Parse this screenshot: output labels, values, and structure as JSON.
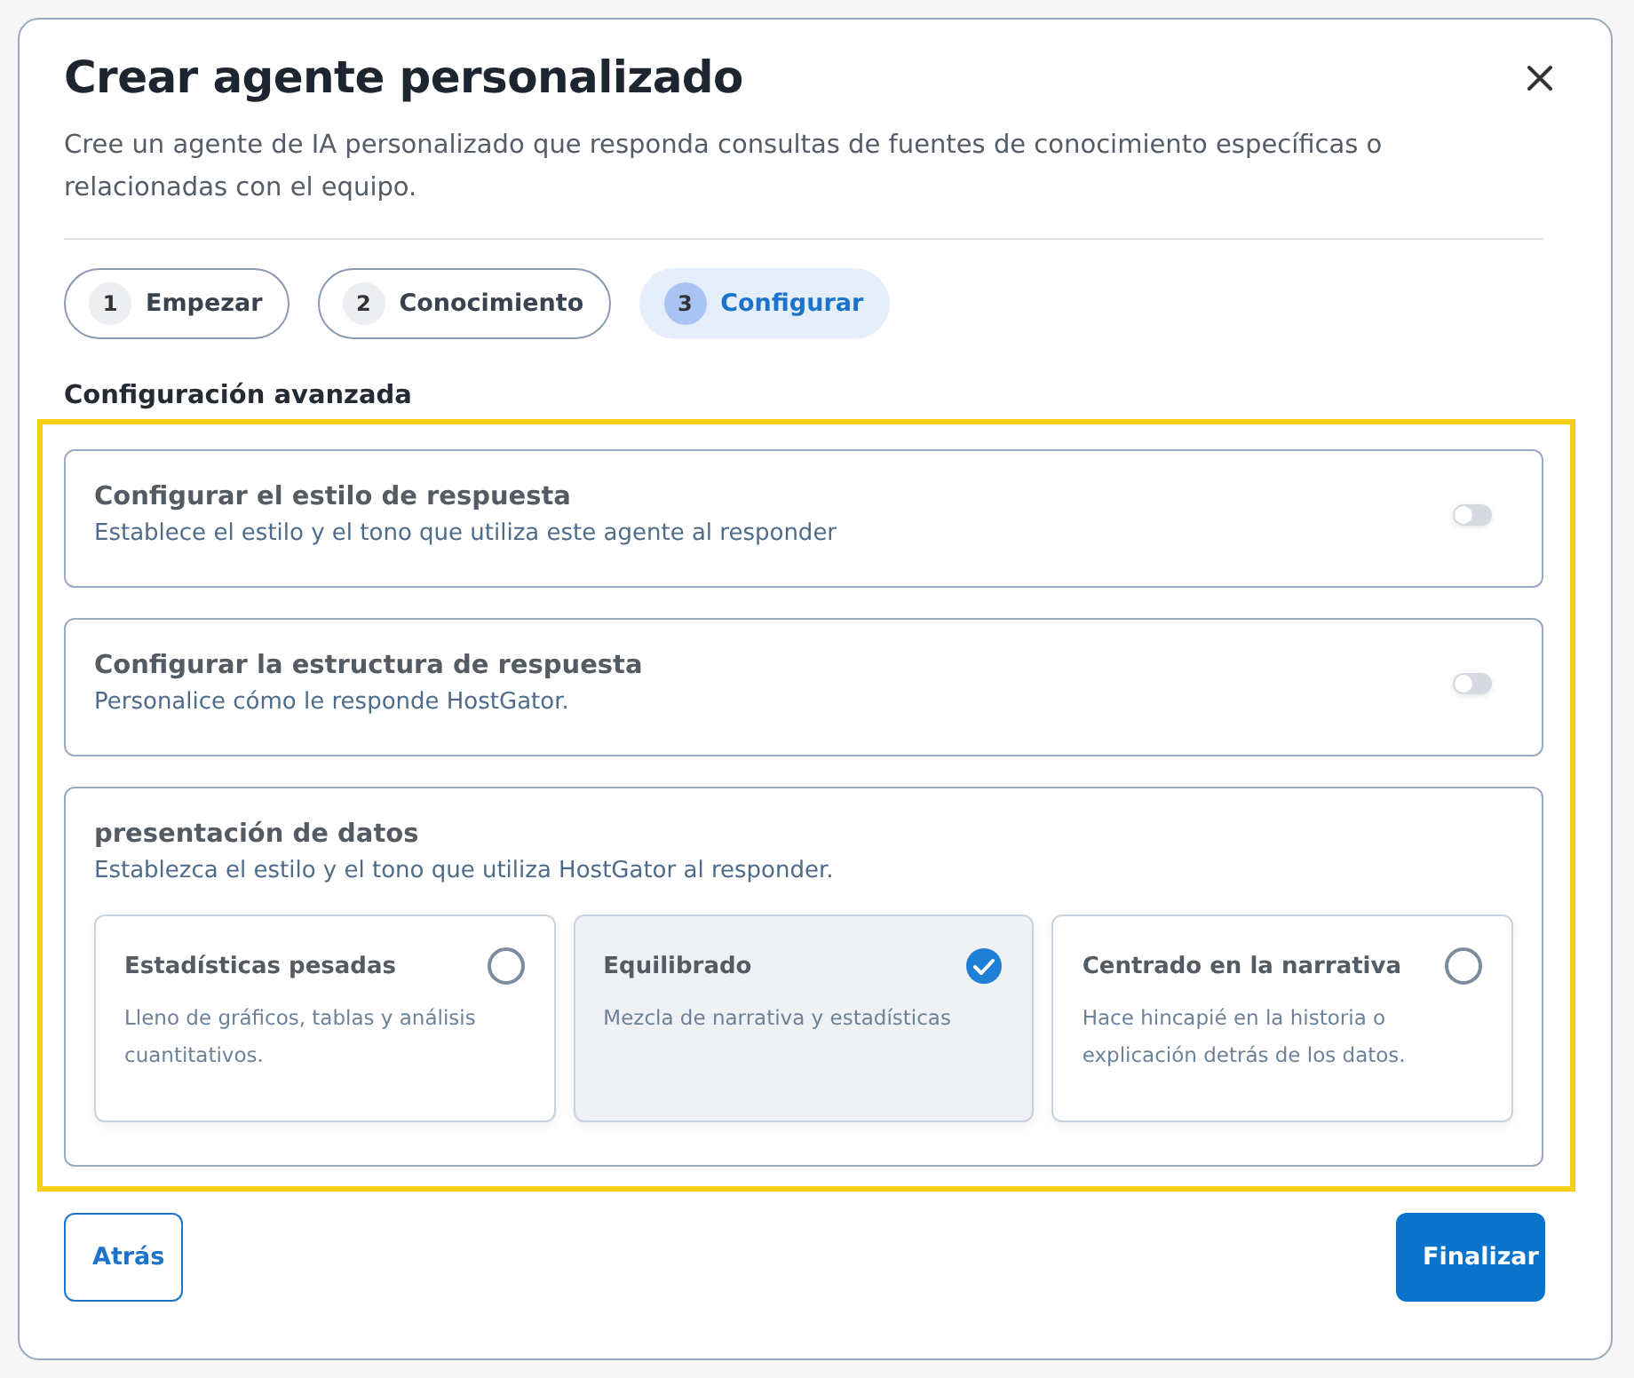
{
  "dialog": {
    "title": "Crear agente personalizado",
    "description": "Cree un agente de IA personalizado que responda consultas de fuentes de conocimiento específicas o relacionadas con el equipo."
  },
  "steps": [
    {
      "number": "1",
      "label": "Empezar",
      "selected": false
    },
    {
      "number": "2",
      "label": "Conocimiento",
      "selected": false
    },
    {
      "number": "3",
      "label": "Configurar",
      "selected": true
    }
  ],
  "section_title": "Configuración avanzada",
  "settings": [
    {
      "kind": "toggle",
      "title": "Configurar el estilo de respuesta",
      "description": "Establece el estilo y el tono que utiliza este agente al responder",
      "on": false
    },
    {
      "kind": "toggle",
      "title": "Configurar la estructura de respuesta",
      "description": "Personalice cómo le responde HostGator.",
      "on": false
    },
    {
      "kind": "options",
      "title": "presentación de datos",
      "description": "Establezca el estilo y el tono que utiliza HostGator al responder.",
      "options": [
        {
          "title": "Estadísticas pesadas",
          "description": "Lleno de gráficos, tablas y análisis cuantitativos.",
          "selected": false
        },
        {
          "title": "Equilibrado",
          "description": "Mezcla de narrativa y estadísticas",
          "selected": true
        },
        {
          "title": "Centrado en la narrativa",
          "description": "Hace hincapié en la historia o explicación detrás de los datos.",
          "selected": false
        }
      ]
    }
  ],
  "footer": {
    "back": "Atrás",
    "finish": "Finalizar"
  }
}
